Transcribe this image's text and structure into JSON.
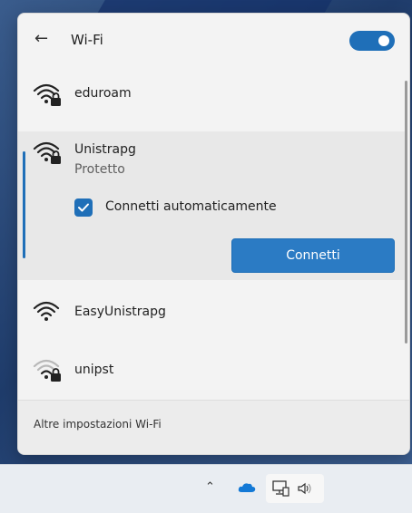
{
  "header": {
    "back_icon": "back-arrow-icon",
    "title": "Wi-Fi",
    "toggle_state": "on"
  },
  "networks": [
    {
      "name": "eduroam",
      "icon": "wifi-secured-icon"
    },
    {
      "name": "Unistrapg",
      "status": "Protetto",
      "icon": "wifi-secured-icon",
      "auto_connect_label": "Connetti automaticamente",
      "auto_connect_checked": true,
      "connect_label": "Connetti"
    },
    {
      "name": "EasyUnistrapg",
      "icon": "wifi-icon"
    },
    {
      "name": "unipst",
      "icon": "wifi-weak-secured-icon"
    }
  ],
  "footer": {
    "more_settings": "Altre impostazioni Wi-Fi"
  },
  "taskbar": {
    "icons": [
      "chevron-up-icon",
      "onedrive-cloud-icon",
      "network-monitor-icon",
      "speaker-icon"
    ]
  },
  "colors": {
    "accent": "#1f6fb8",
    "button": "#2b7bc4"
  }
}
